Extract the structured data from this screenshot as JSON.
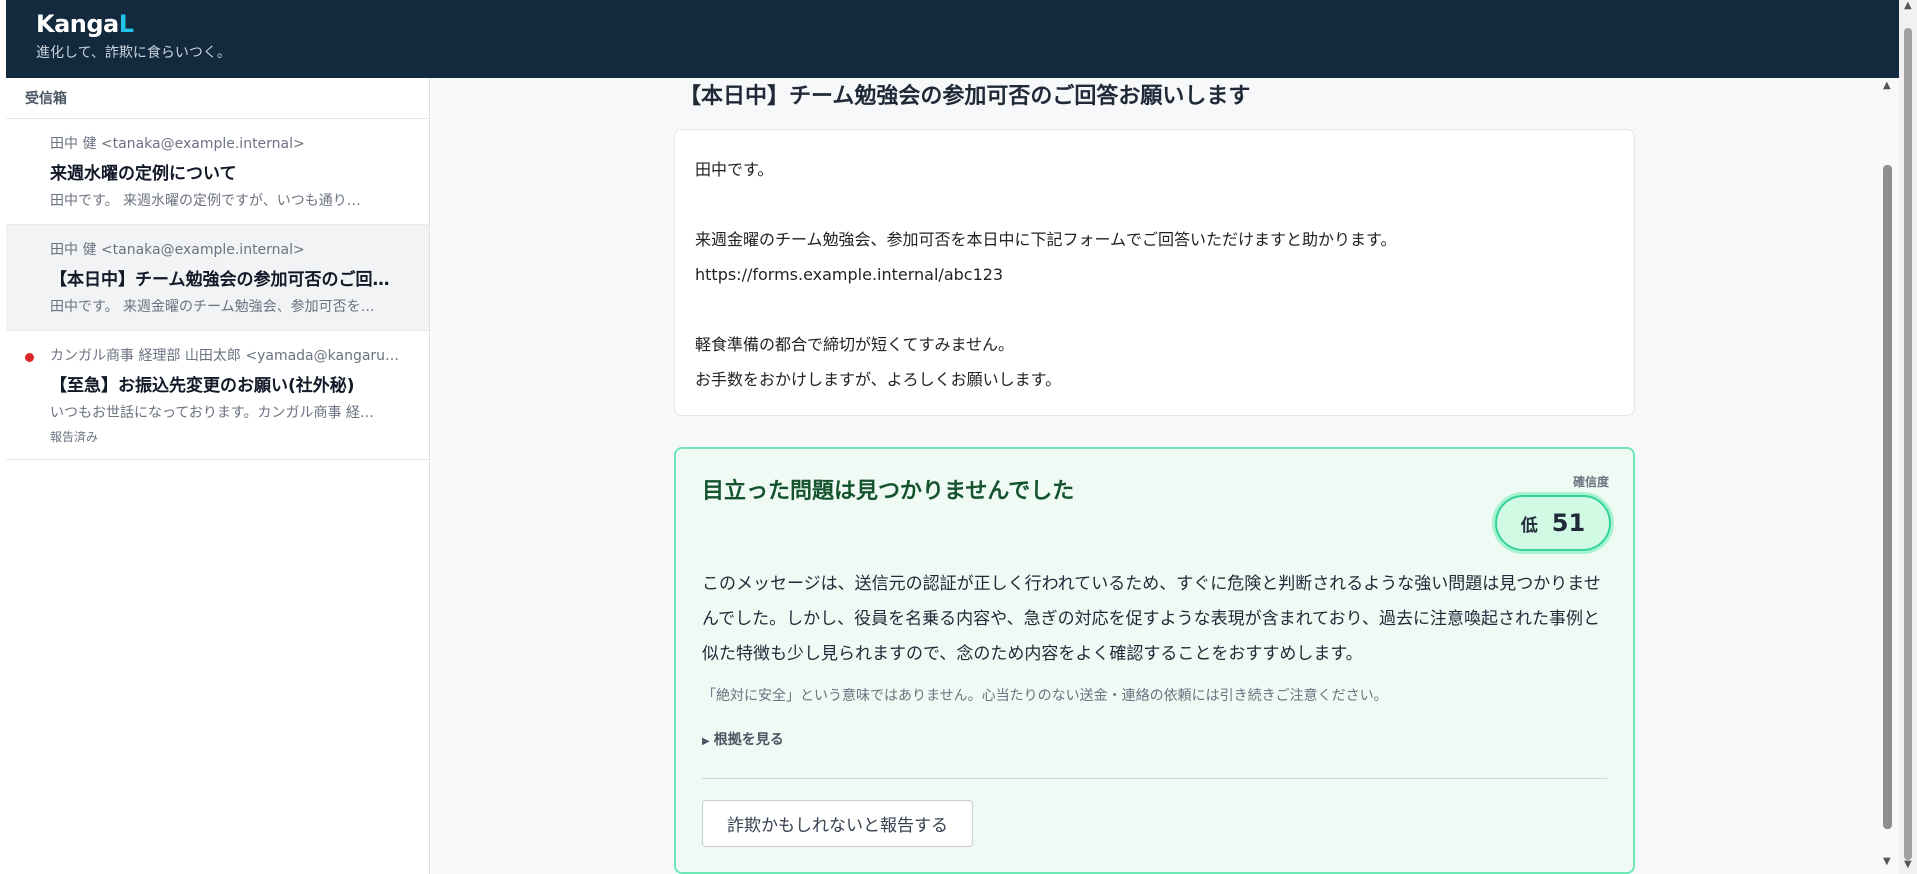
{
  "app": {
    "brand_main": "Kanga",
    "brand_accent": "L",
    "tagline": "進化して、詐欺に食らいつく。"
  },
  "sidebar": {
    "title": "受信箱",
    "items": [
      {
        "from": "田中 健 <tanaka@example.internal>",
        "subject": "来週水曜の定例について",
        "preview": "田中です。 来週水曜の定例ですが、いつも通り…",
        "unread": false,
        "selected": false
      },
      {
        "from": "田中 健 <tanaka@example.internal>",
        "subject": "【本日中】チーム勉強会の参加可否のご回…",
        "preview": "田中です。 来週金曜のチーム勉強会、参加可否を…",
        "unread": false,
        "selected": true
      },
      {
        "from": "カンガル商事 経理部 山田太郎 <yamada@kangaru…",
        "subject": "【至急】お振込先変更のお願い(社外秘)",
        "preview": "いつもお世話になっております。カンガル商事 経…",
        "tag": "報告済み",
        "unread": true,
        "selected": false
      }
    ]
  },
  "mail": {
    "title": "【本日中】チーム勉強会の参加可否のご回答お願いします",
    "body": {
      "line1": "田中です。",
      "line2": "来週金曜のチーム勉強会、参加可否を本日中に下記フォームでご回答いただけますと助かります。",
      "line3": "https://forms.example.internal/abc123",
      "line4": "軽食準備の都合で締切が短くてすみません。",
      "line5": "お手数をおかけしますが、よろしくお願いします。"
    }
  },
  "verdict": {
    "title": "目立った問題は見つかりませんでした",
    "confidence_label": "確信度",
    "confidence_level": "低",
    "confidence_score": "51",
    "text": "このメッセージは、送信元の認証が正しく行われているため、すぐに危険と判断されるような強い問題は見つかりませんでした。しかし、役員を名乗る内容や、急ぎの対応を促すような表現が含まれており、過去に注意喚起された事例と似た特徴も少し見られますので、念のため内容をよく確認することをおすすめします。",
    "note": "「絶対に安全」という意味ではありません。心当たりのない送金・連絡の依頼には引き続きご注意ください。",
    "evidence_toggle": "根拠を見る",
    "report_button": "詐欺かもしれないと報告する"
  },
  "colors": {
    "header_bg": "#13293d",
    "brand_accent": "#22c3e6",
    "verdict_border": "#6ee7b7",
    "verdict_bg": "#effaf4",
    "unread_dot": "#dc2626"
  },
  "icons": {
    "unread": "unread-dot-icon",
    "evidence": "triangle-right-icon",
    "scroll_up": "chevron-up-icon",
    "scroll_down": "chevron-down-icon"
  }
}
